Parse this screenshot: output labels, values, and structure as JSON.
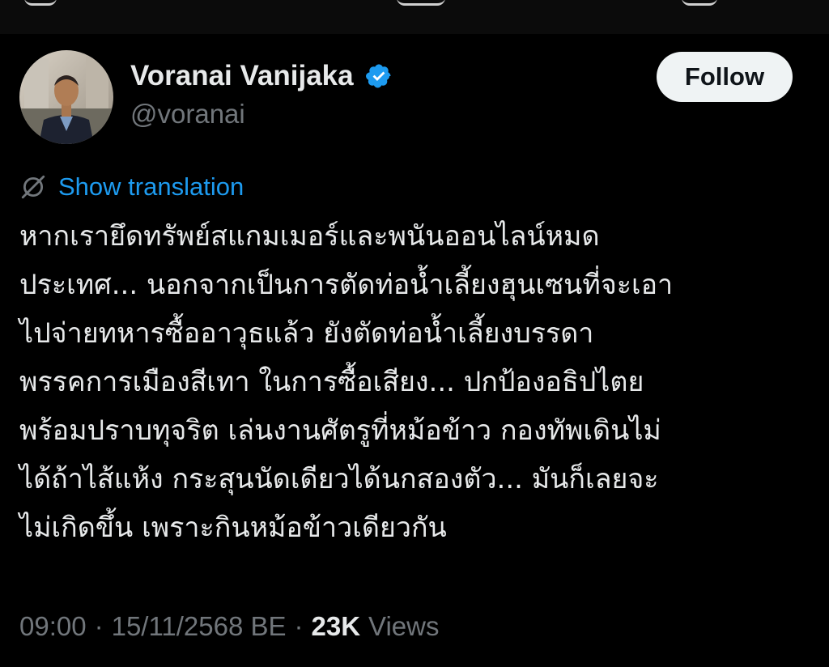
{
  "author": {
    "display_name": "Voranai Vanijaka",
    "handle": "@voranai",
    "verified": true
  },
  "follow_button": {
    "label": "Follow"
  },
  "translation": {
    "label": "Show translation"
  },
  "tweet": {
    "text": "หากเรายึดทรัพย์สแกมเมอร์และพนันออนไลน์หมด\nประเทศ... นอกจากเป็นการตัดท่อน้ำเลี้ยงฮุนเซนที่จะเอา\nไปจ่ายทหารซื้ออาวุธแล้ว ยังตัดท่อน้ำเลี้ยงบรรดา\nพรรคการเมืองสีเทา ในการซื้อเสียง... ปกป้องอธิปไตย\nพร้อมปราบทุจริต เล่นงานศัตรูที่หม้อข้าว กองทัพเดินไม่\nได้ถ้าไส้แห้ง กระสุนนัดเดียวได้นกสองตัว... มันก็เลยจะ\nไม่เกิดขึ้น เพราะกินหม้อข้าวเดียวกัน"
  },
  "meta": {
    "time": "09:00",
    "separator": "·",
    "date": "15/11/2568 BE",
    "views_count": "23K",
    "views_label": "Views"
  },
  "colors": {
    "background": "#000000",
    "text_primary": "#e7e9ea",
    "text_secondary": "#71767b",
    "link": "#1d9bf0",
    "verified_badge": "#1d9bf0",
    "follow_button_bg": "#eff3f4"
  },
  "icons": {
    "verified": "verified-badge-icon",
    "translation": "globe-off-icon"
  }
}
